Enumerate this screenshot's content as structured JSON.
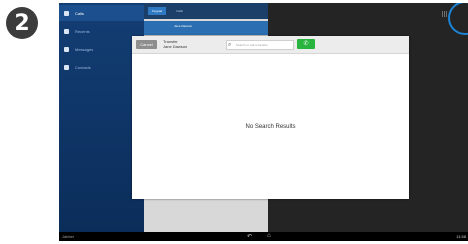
{
  "step_number": "2",
  "sidebar": {
    "items": [
      {
        "label": "Calls",
        "icon": "phone-icon",
        "active": true
      },
      {
        "label": "Recents",
        "icon": "clock-icon",
        "active": false
      },
      {
        "label": "Messages",
        "icon": "message-icon",
        "active": false
      },
      {
        "label": "Contacts",
        "icon": "person-icon",
        "active": false
      }
    ]
  },
  "middle": {
    "tabs": [
      "Keypad",
      "Calls"
    ],
    "caller_name": "Jane Dawson"
  },
  "dialog": {
    "cancel_label": "Cancel",
    "title": "Transfer",
    "subtitle": "Jane Dawson",
    "search_placeholder": "Search or call a transfer",
    "call_icon": "phone-icon",
    "empty_message": "No Search Results"
  },
  "statusbar": {
    "left_text": "Jabber",
    "time": "11:58"
  },
  "colors": {
    "sidebar": "#133e74",
    "call_button": "#29b43f",
    "highlight": "#2b6fb2",
    "ring": "#1b84d6"
  }
}
